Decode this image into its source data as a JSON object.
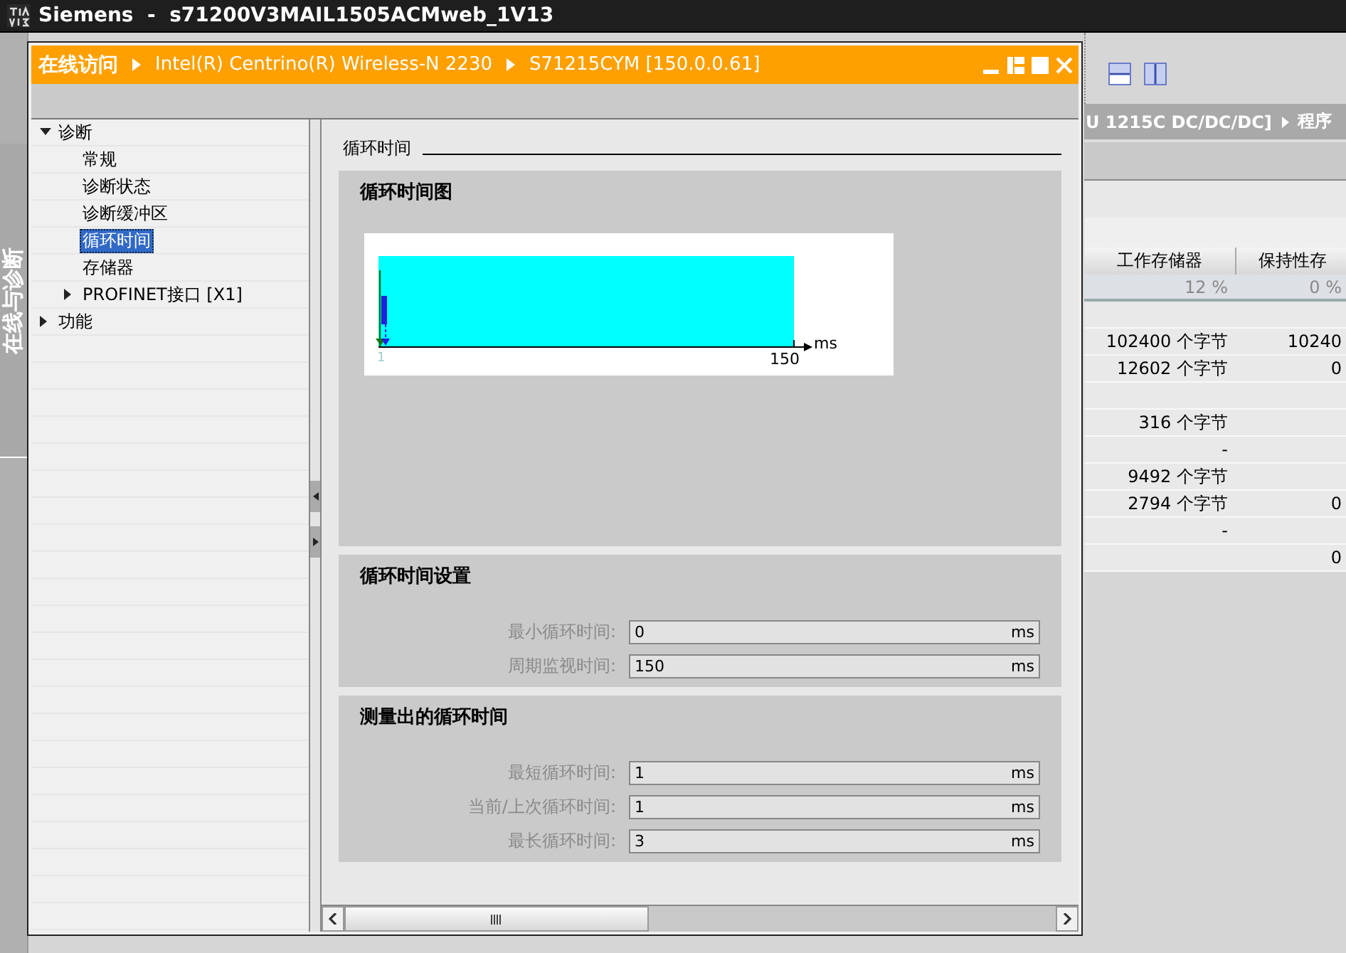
{
  "app_title": "Siemens  -  s71200V3MAIL1505ACMweb_1V13",
  "side_tab": "在线与诊断",
  "editor": {
    "breadcrumb": [
      "U 1215C DC/DC/DC]",
      "程序"
    ],
    "table": {
      "columns": [
        "工作存储器",
        "保持性存"
      ],
      "rows": [
        {
          "kind": "summary",
          "cells": [
            "12 %",
            "0 %"
          ]
        },
        {
          "kind": "data",
          "cells": [
            "",
            ""
          ]
        },
        {
          "kind": "data",
          "cells": [
            "102400 个字节",
            "10240"
          ]
        },
        {
          "kind": "data",
          "cells": [
            "12602 个字节",
            "0"
          ]
        },
        {
          "kind": "data",
          "cells": [
            "",
            ""
          ]
        },
        {
          "kind": "data",
          "cells": [
            "316 个字节",
            ""
          ]
        },
        {
          "kind": "data",
          "cells": [
            "-",
            ""
          ]
        },
        {
          "kind": "data",
          "cells": [
            "9492 个字节",
            ""
          ]
        },
        {
          "kind": "data",
          "cells": [
            "2794 个字节",
            "0"
          ]
        },
        {
          "kind": "data",
          "cells": [
            "-",
            ""
          ]
        },
        {
          "kind": "data",
          "cells": [
            "",
            "0"
          ]
        }
      ]
    }
  },
  "dialog": {
    "breadcrumb": [
      "在线访问",
      "Intel(R) Centrino(R) Wireless-N 2230",
      "S71215CYM [150.0.0.61]"
    ],
    "tree": [
      {
        "label": "诊断",
        "selected": false,
        "expanded": true,
        "children": [
          {
            "label": "常规",
            "selected": false
          },
          {
            "label": "诊断状态",
            "selected": false
          },
          {
            "label": "诊断缓冲区",
            "selected": false
          },
          {
            "label": "循环时间",
            "selected": true
          },
          {
            "label": "存储器",
            "selected": false
          },
          {
            "label": "PROFINET接口 [X1]",
            "selected": false,
            "expanded": false
          }
        ]
      },
      {
        "label": "功能",
        "selected": false,
        "expanded": false
      }
    ],
    "section_title": "循环时间",
    "groups": [
      {
        "title": "循环时间图",
        "kind": "diagram",
        "diagram": {
          "min_label": "1",
          "max_label": "150",
          "unit": "ms"
        }
      },
      {
        "title": "循环时间设置",
        "kind": "fields",
        "fields": [
          {
            "label": "最小循环时间:",
            "value": "0",
            "unit": "ms"
          },
          {
            "label": "周期监视时间:",
            "value": "150",
            "unit": "ms"
          }
        ]
      },
      {
        "title": "测量出的循环时间",
        "kind": "fields",
        "fields": [
          {
            "label": "最短循环时间:",
            "value": "1",
            "unit": "ms"
          },
          {
            "label": "当前/上次循环时间:",
            "value": "1",
            "unit": "ms"
          },
          {
            "label": "最长循环时间:",
            "value": "3",
            "unit": "ms"
          }
        ]
      }
    ]
  }
}
